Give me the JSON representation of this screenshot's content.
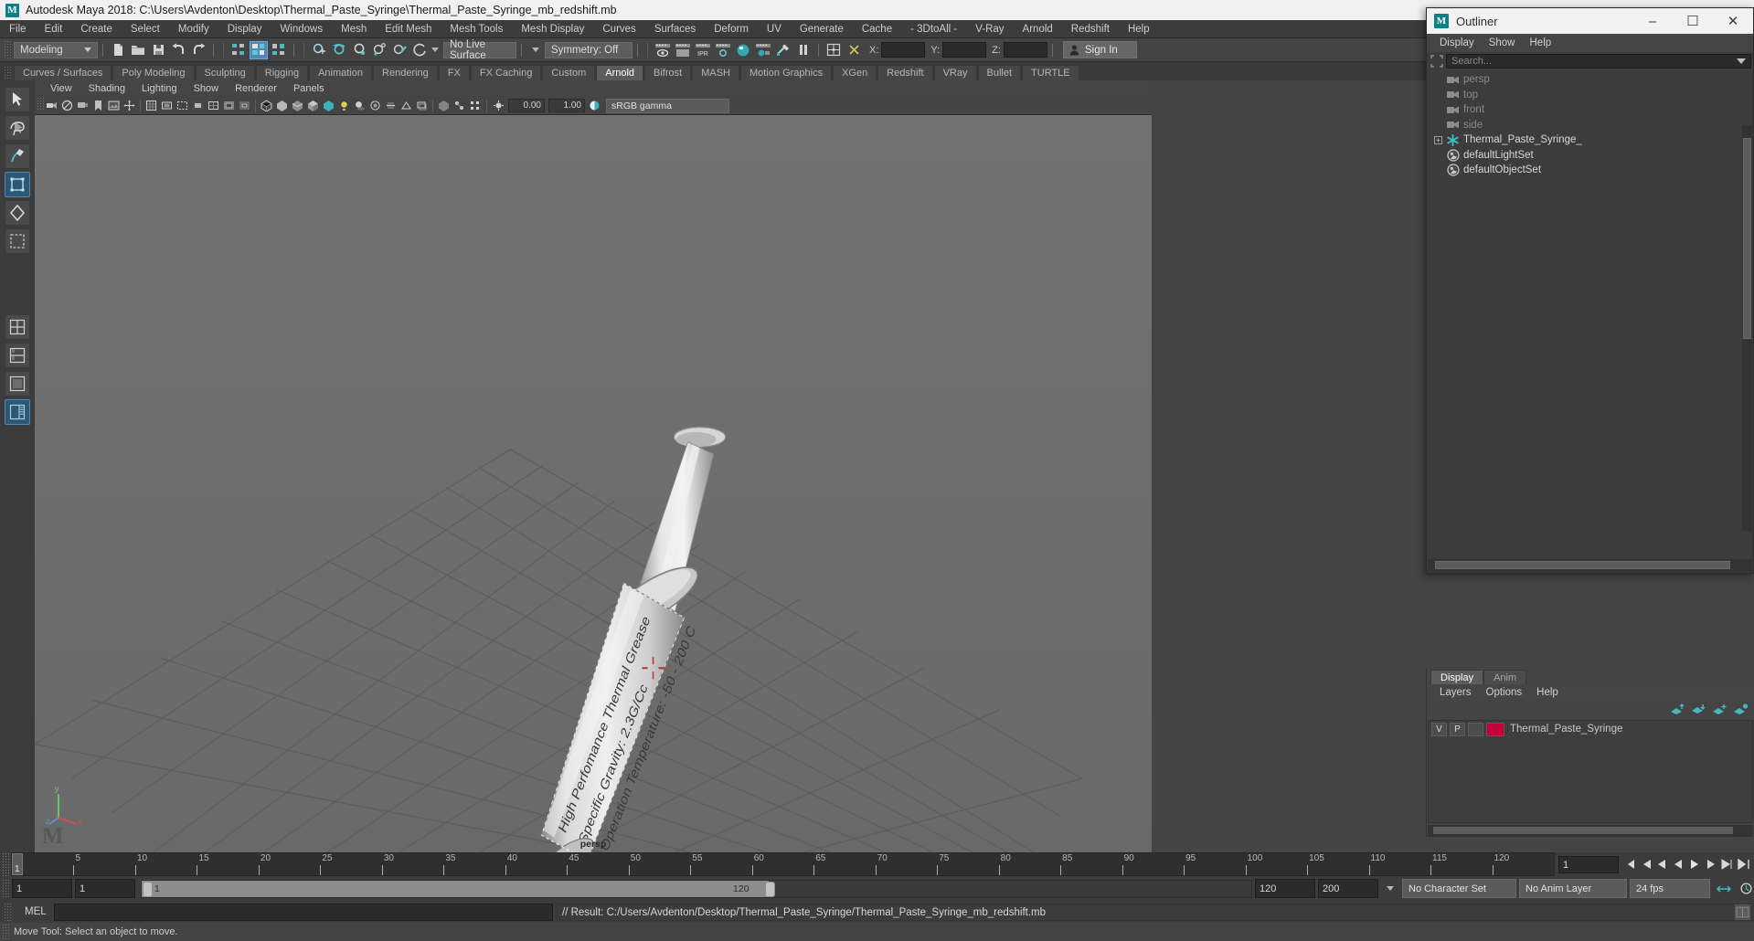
{
  "titlebar": {
    "app_icon": "maya-logo-icon",
    "title": "Autodesk Maya 2018: C:\\Users\\Avdenton\\Desktop\\Thermal_Paste_Syringe\\Thermal_Paste_Syringe_mb_redshift.mb"
  },
  "main_menu": [
    "File",
    "Edit",
    "Create",
    "Select",
    "Modify",
    "Display",
    "Windows",
    "Mesh",
    "Edit Mesh",
    "Mesh Tools",
    "Mesh Display",
    "Curves",
    "Surfaces",
    "Deform",
    "UV",
    "Generate",
    "Cache",
    "- 3DtoAll -",
    "V-Ray",
    "Arnold",
    "Redshift",
    "Help"
  ],
  "status_line": {
    "menu_set": "Modeling",
    "live_surface": "No Live Surface",
    "symmetry": "Symmetry: Off",
    "coord_labels": {
      "x": "X:",
      "y": "Y:",
      "z": "Z:"
    },
    "coord_values": {
      "x": "",
      "y": "",
      "z": ""
    },
    "sign_in": "Sign In",
    "icons": [
      "new-scene-icon",
      "open-scene-icon",
      "save-scene-icon",
      "undo-icon",
      "redo-icon",
      "select-by-hierarchy-icon",
      "select-by-object-icon",
      "select-by-component-icon",
      "snap-to-grid-icon",
      "snap-to-curve-icon",
      "snap-to-point-icon",
      "snap-to-projected-center-icon",
      "snap-to-view-plane-icon",
      "make-live-icon",
      "render-view-icon",
      "render-current-frame-icon",
      "ipr-render-icon",
      "render-settings-icon",
      "hypershade-icon",
      "render-sequence-icon",
      "light-editor-icon",
      "pause-icon",
      "toggle-editors-icon",
      "numeric-input-icon",
      "absolute-transform-icon",
      "user-account-icon"
    ]
  },
  "shelf_tabs": [
    {
      "label": "Curves / Surfaces",
      "selected": false
    },
    {
      "label": "Poly Modeling",
      "selected": false
    },
    {
      "label": "Sculpting",
      "selected": false
    },
    {
      "label": "Rigging",
      "selected": false
    },
    {
      "label": "Animation",
      "selected": false
    },
    {
      "label": "Rendering",
      "selected": false
    },
    {
      "label": "FX",
      "selected": false
    },
    {
      "label": "FX Caching",
      "selected": false
    },
    {
      "label": "Custom",
      "selected": false
    },
    {
      "label": "Arnold",
      "selected": true
    },
    {
      "label": "Bifrost",
      "selected": false
    },
    {
      "label": "MASH",
      "selected": false
    },
    {
      "label": "Motion Graphics",
      "selected": false
    },
    {
      "label": "XGen",
      "selected": false
    },
    {
      "label": "Redshift",
      "selected": false
    },
    {
      "label": "VRay",
      "selected": false
    },
    {
      "label": "Bullet",
      "selected": false
    },
    {
      "label": "TURTLE",
      "selected": false
    }
  ],
  "shelf_icons": [
    "arnold-area-light-icon",
    "arnold-skydome-light-icon",
    "arnold-mesh-light-icon",
    "arnold-photometric-light-icon",
    "arnold-light-portal-icon",
    "arnold-physical-sky-icon",
    "arnold-standin-icon",
    "arnold-standin-export-icon",
    "arnold-volume-icon",
    "arnold-scene-source-icon",
    "arnold-render-icon",
    "arnold-render-selected-icon",
    "arnold-flush-caches-icon",
    "arnold-open-render-view-icon",
    "arnold-tx-manager-icon"
  ],
  "toolbox": [
    "select-tool-icon",
    "lasso-select-tool-icon",
    "paint-select-tool-icon",
    "move-tool-icon",
    "rotate-tool-icon",
    "scale-tool-icon",
    "four-view-layout-icon",
    "two-pane-stacked-layout-icon",
    "single-perspective-layout-icon",
    "persp-outliner-layout-icon"
  ],
  "viewport": {
    "menu": [
      "View",
      "Shading",
      "Lighting",
      "Show",
      "Renderer",
      "Panels"
    ],
    "camera_label": "persp",
    "toolbar_icons": [
      "select-camera-icon",
      "lock-camera-icon",
      "camera-attributes-icon",
      "bookmark-icon",
      "image-plane-icon",
      "two-d-pan-zoom-icon",
      "grid-toggle-icon",
      "film-gate-icon",
      "resolution-gate-icon",
      "gate-mask-icon",
      "field-chart-icon",
      "safe-action-icon",
      "safe-title-icon",
      "wireframe-shading-icon",
      "smooth-shade-all-icon",
      "smooth-shade-selected-icon",
      "flat-shade-icon",
      "shaded-wireframe-icon",
      "texture-toggle-icon",
      "lighting-toggle-icon",
      "shadow-toggle-icon",
      "screen-space-ao-icon",
      "motion-blur-icon",
      "multisample-toggle-icon",
      "depth-peeling-icon",
      "xray-toggle-icon",
      "xray-joints-icon",
      "xray-active-components-icon",
      "exposure-icon",
      "gamma-icon",
      "view-transform-icon"
    ],
    "exposure_value": "0.00",
    "gamma_value": "1.00",
    "color_transform": "sRGB gamma",
    "axis_labels": {
      "y": "y",
      "x": "x",
      "z": "z"
    },
    "watermark": "M"
  },
  "outliner": {
    "window_title": "Outliner",
    "window_buttons": {
      "minimize": "–",
      "maximize": "☐",
      "close": "✕"
    },
    "menu": [
      "Display",
      "Show",
      "Help"
    ],
    "search_placeholder": "Search...",
    "items": [
      {
        "label": "persp",
        "icon": "camera-icon",
        "dim": true,
        "expander": false
      },
      {
        "label": "top",
        "icon": "camera-icon",
        "dim": true,
        "expander": false
      },
      {
        "label": "front",
        "icon": "camera-icon",
        "dim": true,
        "expander": false
      },
      {
        "label": "side",
        "icon": "camera-icon",
        "dim": true,
        "expander": false
      },
      {
        "label": "Thermal_Paste_Syringe_",
        "icon": "transform-group-icon",
        "dim": false,
        "expander": true
      },
      {
        "label": "defaultLightSet",
        "icon": "object-set-icon",
        "dim": false,
        "expander": false
      },
      {
        "label": "defaultObjectSet",
        "icon": "object-set-icon",
        "dim": false,
        "expander": false
      }
    ]
  },
  "layer_editor": {
    "tabs": [
      {
        "label": "Display",
        "selected": true
      },
      {
        "label": "Anim",
        "selected": false
      }
    ],
    "menu": [
      "Layers",
      "Options",
      "Help"
    ],
    "tool_icons": [
      "move-layer-up-icon",
      "move-layer-down-icon",
      "add-layer-icon",
      "new-layer-icon"
    ],
    "layers": [
      {
        "visibility": "V",
        "playback": "P",
        "color": "#c4003c",
        "name": "Thermal_Paste_Syringe"
      }
    ]
  },
  "time_slider": {
    "current_frame": "1",
    "ticks": [
      "5",
      "10",
      "15",
      "20",
      "25",
      "30",
      "35",
      "40",
      "45",
      "50",
      "55",
      "60",
      "65",
      "70",
      "75",
      "80",
      "85",
      "90",
      "95",
      "100",
      "105",
      "110",
      "115",
      "120"
    ],
    "field_value": "1",
    "playback_icons": [
      "go-to-start-icon",
      "step-back-frame-icon",
      "step-back-key-icon",
      "play-backwards-icon",
      "play-forwards-icon",
      "step-forward-key-icon",
      "step-forward-frame-icon",
      "go-to-end-icon"
    ]
  },
  "range_slider": {
    "anim_start": "1",
    "range_start": "1",
    "bar_start_label": "1",
    "bar_end_label": "120",
    "range_end": "120",
    "anim_end": "200",
    "character_set": "No Character Set",
    "anim_layer": "No Anim Layer",
    "fps": "24 fps",
    "right_icons": [
      "auto-keyframe-icon",
      "animation-preferences-icon"
    ]
  },
  "command_line": {
    "language_label": "MEL",
    "input_value": "",
    "result_text": "// Result: C:/Users/Avdenton/Desktop/Thermal_Paste_Syringe/Thermal_Paste_Syringe_mb_redshift.mb"
  },
  "help_line": {
    "text": "Move Tool: Select an object to move.",
    "help_icon": "help-book-icon"
  },
  "colors": {
    "accent_teal": "#26a0a8",
    "accent_blue": "#4f87b5",
    "layer_red": "#c4003c",
    "panel_bg": "#444444",
    "viewport_bg": "#6e6e6e"
  }
}
